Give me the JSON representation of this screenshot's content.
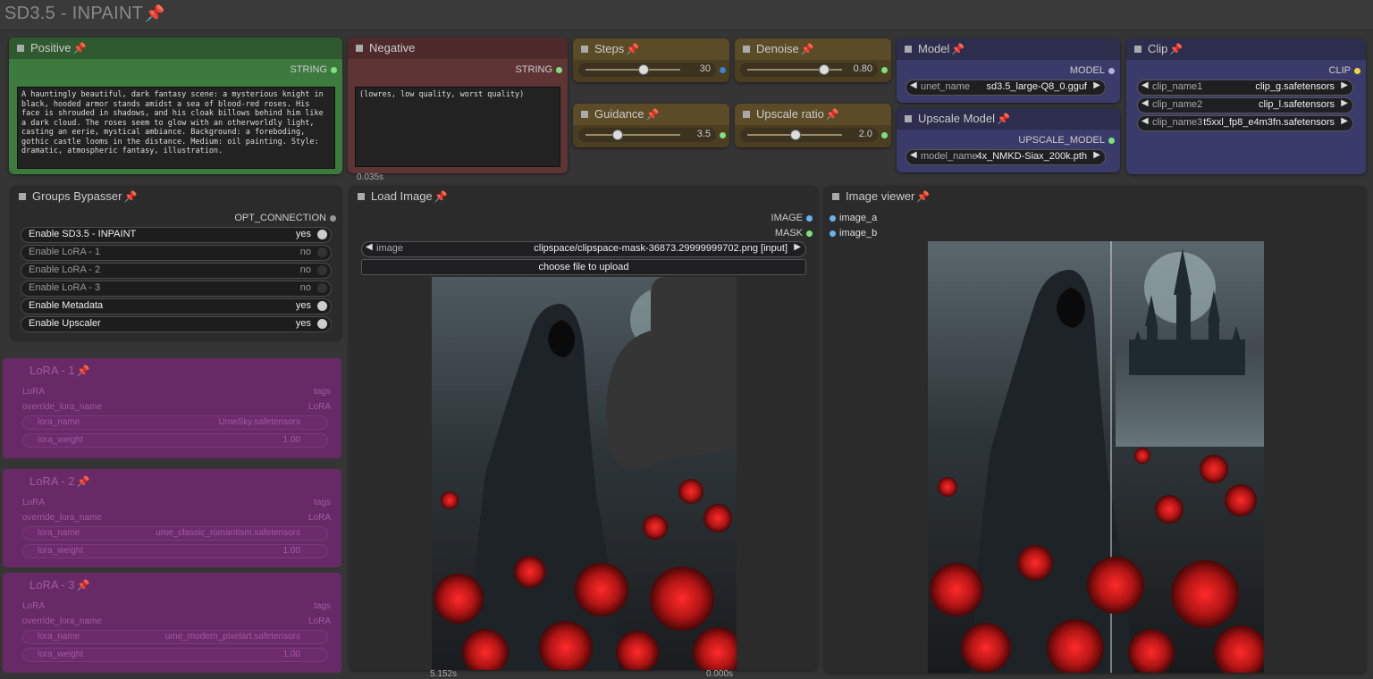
{
  "group": {
    "title": "SD3.5 - INPAINT"
  },
  "positive": {
    "title": "Positive",
    "output": "STRING",
    "text": "A hauntingly beautiful, dark fantasy scene: a mysterious knight in black, hooded armor stands amidst a sea of blood-red roses. His face is shrouded in shadows, and his cloak billows behind him like a dark cloud. The roses seem to glow with an otherworldly light, casting an eerie, mystical ambiance. Background: a foreboding, gothic castle looms in the distance. Medium: oil painting. Style: dramatic, atmospheric fantasy, illustration."
  },
  "negative": {
    "title": "Negative",
    "output": "STRING",
    "text": "(lowres, low quality, worst quality)",
    "timing": "0.035s"
  },
  "steps": {
    "title": "Steps",
    "value": "30",
    "fraction": 0.48
  },
  "denoise": {
    "title": "Denoise",
    "value": "0.80",
    "fraction": 0.8
  },
  "guidance": {
    "title": "Guidance",
    "value": "3.5",
    "fraction": 0.26
  },
  "upscale_ratio": {
    "title": "Upscale ratio",
    "value": "2.0",
    "fraction": 0.5
  },
  "model": {
    "title": "Model",
    "output": "MODEL",
    "label": "unet_name",
    "value": "sd3.5_large-Q8_0.gguf"
  },
  "upscale_model": {
    "title": "Upscale Model",
    "output": "UPSCALE_MODEL",
    "label": "model_name",
    "value": "4x_NMKD-Siax_200k.pth"
  },
  "clip": {
    "title": "Clip",
    "output": "CLIP",
    "rows": [
      {
        "label": "clip_name1",
        "value": "clip_g.safetensors"
      },
      {
        "label": "clip_name2",
        "value": "clip_l.safetensors"
      },
      {
        "label": "clip_name3",
        "value": "t5xxl_fp8_e4m3fn.safetensors"
      }
    ]
  },
  "bypasser": {
    "title": "Groups Bypasser",
    "output": "OPT_CONNECTION",
    "toggles": [
      {
        "label": "Enable SD3.5 - INPAINT",
        "value": "yes",
        "on": true
      },
      {
        "label": "Enable LoRA - 1",
        "value": "no",
        "on": false
      },
      {
        "label": "Enable LoRA - 2",
        "value": "no",
        "on": false
      },
      {
        "label": "Enable LoRA - 3",
        "value": "no",
        "on": false
      },
      {
        "label": "Enable Metadata",
        "value": "yes",
        "on": true
      },
      {
        "label": "Enable Upscaler",
        "value": "yes",
        "on": true
      }
    ]
  },
  "loras": [
    {
      "title": "LoRA - 1",
      "in": "LoRA",
      "out": "tags",
      "override": "override_lora_name",
      "override_out": "LoRA",
      "name_label": "lora_name",
      "name_value": "UmeSky.safetensors",
      "weight_label": "lora_weight",
      "weight_value": "1.00"
    },
    {
      "title": "LoRA - 2",
      "in": "LoRA",
      "out": "tags",
      "override": "override_lora_name",
      "override_out": "LoRA",
      "name_label": "lora_name",
      "name_value": "ume_classic_romantism.safetensors",
      "weight_label": "lora_weight",
      "weight_value": "1.00"
    },
    {
      "title": "LoRA - 3",
      "in": "LoRA",
      "out": "tags",
      "override": "override_lora_name",
      "override_out": "LoRA",
      "name_label": "lora_name",
      "name_value": "ume_modern_pixelart.safetensors",
      "weight_label": "lora_weight",
      "weight_value": "1.00"
    }
  ],
  "load_image": {
    "title": "Load Image",
    "out1": "IMAGE",
    "out2": "MASK",
    "label": "image",
    "value": "clipspace/clipspace-mask-36873.29999999702.png [input]",
    "upload": "choose file to upload",
    "timing": "5.152s"
  },
  "viewer": {
    "title": "Image viewer",
    "in1": "image_a",
    "in2": "image_b",
    "timing": "0.000s"
  },
  "colors": {
    "positive_title": "#2f5a2f",
    "positive_body": "#3d7a3d",
    "negative_title": "#4f2a2a",
    "negative_body": "#5e3434",
    "slider_title": "#5b4b27",
    "slider_body": "#4b3e21",
    "model_title": "#2d2d4d",
    "model_body": "#3b3b6b",
    "node_gray": "#2b2b2b",
    "lora": "#6a2a6a"
  }
}
